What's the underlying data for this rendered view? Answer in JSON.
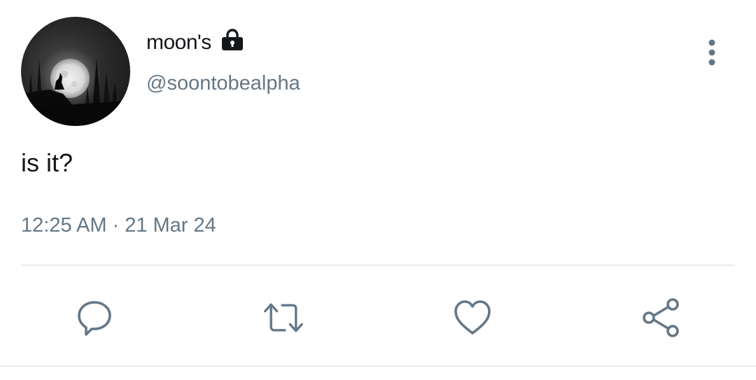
{
  "tweet": {
    "display_name": "moon's",
    "handle": "@soontobealpha",
    "text": "is it?",
    "time": "12:25 AM",
    "separator": "·",
    "date": "21 Mar 24",
    "protected_icon": "lock-icon",
    "avatar_image": "wolf-howling-at-full-moon"
  },
  "actions": [
    {
      "name": "reply",
      "icon": "reply-icon"
    },
    {
      "name": "retweet",
      "icon": "retweet-icon"
    },
    {
      "name": "like",
      "icon": "heart-icon"
    },
    {
      "name": "share",
      "icon": "share-icon"
    }
  ],
  "colors": {
    "primary_text": "#14171a",
    "secondary_text": "#657786",
    "divider": "#e6ecf0"
  }
}
